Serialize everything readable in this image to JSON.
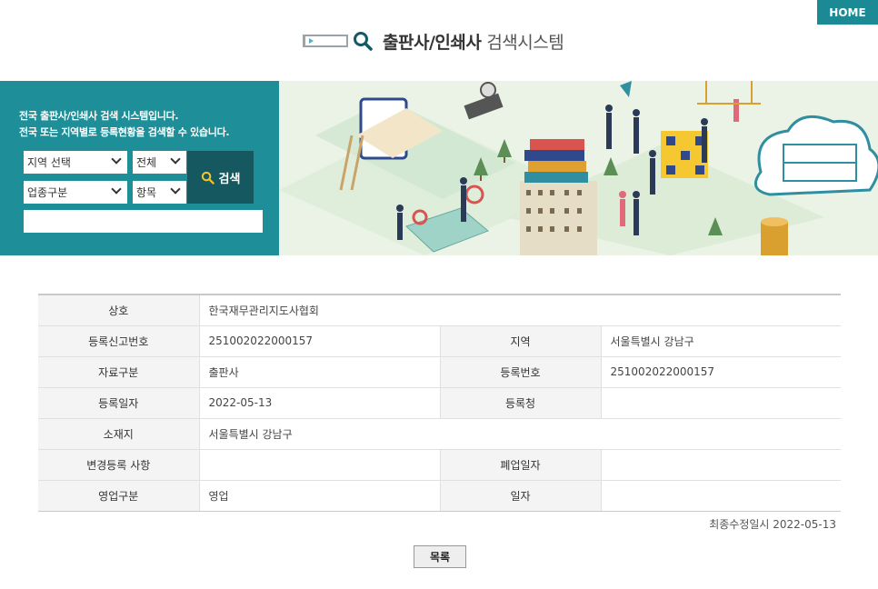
{
  "header": {
    "home_label": "HOME",
    "title_bold": "출판사/인쇄사",
    "title_regular": "검색시스템"
  },
  "search": {
    "intro_line1": "전국 출판사/인쇄사 검색 시스템입니다.",
    "intro_line2": "전국 또는 지역별로 등록현황을 검색할 수 있습니다.",
    "region_select": "지역 선택",
    "scope_select": "전체",
    "type_select": "업종구분",
    "field_select": "항목",
    "button_label": "검색",
    "keyword_value": ""
  },
  "details": {
    "rows": [
      {
        "cells": [
          {
            "label": "상호",
            "value": "한국재무관리지도사협회",
            "span": 3
          }
        ]
      },
      {
        "cells": [
          {
            "label": "등록신고번호",
            "value": "251002022000157"
          },
          {
            "label": "지역",
            "value": "서울특별시 강남구"
          }
        ]
      },
      {
        "cells": [
          {
            "label": "자료구분",
            "value": "출판사"
          },
          {
            "label": "등록번호",
            "value": "251002022000157"
          }
        ]
      },
      {
        "cells": [
          {
            "label": "등록일자",
            "value": "2022-05-13"
          },
          {
            "label": "등록청",
            "value": ""
          }
        ]
      },
      {
        "cells": [
          {
            "label": "소재지",
            "value": "서울특별시 강남구",
            "span": 3
          }
        ]
      },
      {
        "cells": [
          {
            "label": "변경등록 사항",
            "value": ""
          },
          {
            "label": "폐업일자",
            "value": ""
          }
        ]
      },
      {
        "cells": [
          {
            "label": "영업구분",
            "value": "영업"
          },
          {
            "label": "일자",
            "value": ""
          }
        ]
      }
    ]
  },
  "footer": {
    "updated_text": "최종수정일시 2022-05-13",
    "list_button": "목록"
  },
  "colors": {
    "accent": "#1e8f98",
    "accent_dark": "#155860"
  }
}
